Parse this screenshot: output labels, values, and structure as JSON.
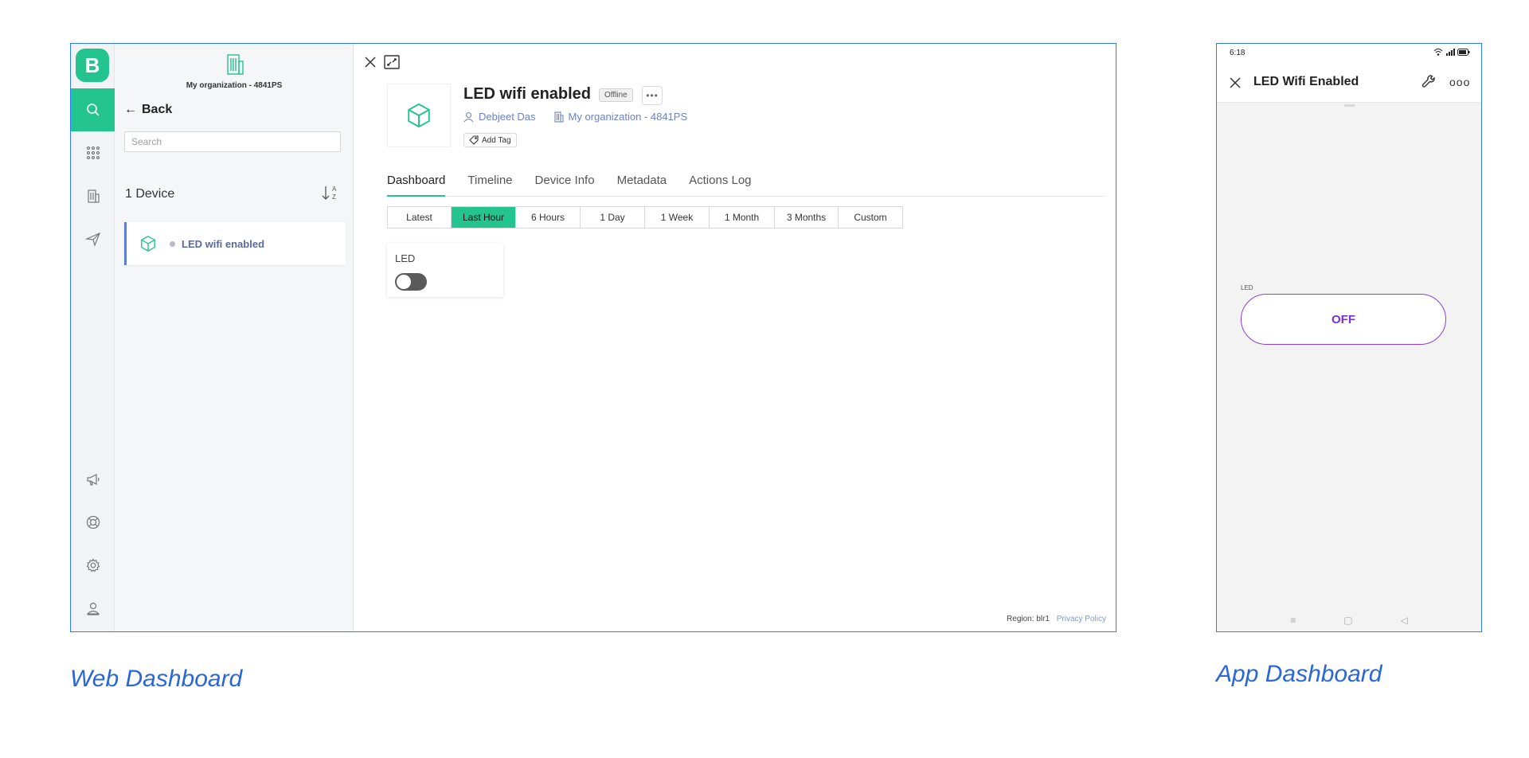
{
  "web": {
    "caption": "Web Dashboard",
    "brand_letter": "B",
    "org_name": "My organization - 4841PS",
    "back_label": "Back",
    "search_placeholder": "Search",
    "device_count": "1 Device",
    "devices": [
      {
        "name": "LED wifi enabled"
      }
    ],
    "device": {
      "title": "LED wifi enabled",
      "status": "Offline",
      "more_label": "•••",
      "owner": "Debjeet Das",
      "organization": "My organization - 4841PS",
      "add_tag": "Add Tag"
    },
    "tabs": [
      "Dashboard",
      "Timeline",
      "Device Info",
      "Metadata",
      "Actions Log"
    ],
    "active_tab": "Dashboard",
    "time_ranges": [
      "Latest",
      "Last Hour",
      "6 Hours",
      "1 Day",
      "1 Week",
      "1 Month",
      "3 Months",
      "Custom"
    ],
    "active_time_range": "Last Hour",
    "widget": {
      "label": "LED",
      "state": "off"
    },
    "footer": {
      "region": "Region: blr1",
      "privacy": "Privacy Policy"
    },
    "accent_color": "#23c48e"
  },
  "app": {
    "caption": "App Dashboard",
    "time": "6:18",
    "title": "LED Wifi Enabled",
    "more_label": "ooo",
    "widget_label": "LED",
    "button_label": "OFF",
    "button_color": "#7a2fd8",
    "nav": [
      "≡",
      "▢",
      "◁"
    ]
  }
}
